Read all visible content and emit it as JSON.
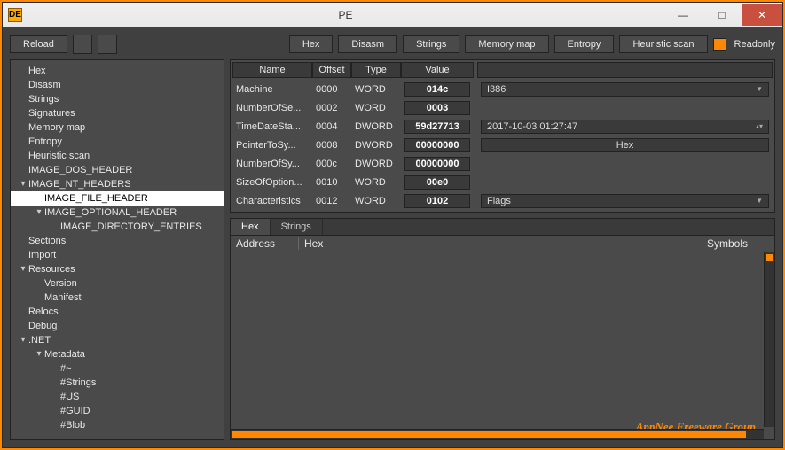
{
  "window": {
    "title": "PE",
    "icon": "DE"
  },
  "toolbar": {
    "reload": "Reload",
    "hex": "Hex",
    "disasm": "Disasm",
    "strings": "Strings",
    "memory_map": "Memory map",
    "entropy": "Entropy",
    "heuristic": "Heuristic scan",
    "readonly": "Readonly"
  },
  "tree": [
    {
      "lvl": 1,
      "tw": "",
      "label": "Hex"
    },
    {
      "lvl": 1,
      "tw": "",
      "label": "Disasm"
    },
    {
      "lvl": 1,
      "tw": "",
      "label": "Strings"
    },
    {
      "lvl": 1,
      "tw": "",
      "label": "Signatures"
    },
    {
      "lvl": 1,
      "tw": "",
      "label": "Memory map"
    },
    {
      "lvl": 1,
      "tw": "",
      "label": "Entropy"
    },
    {
      "lvl": 1,
      "tw": "",
      "label": "Heuristic scan"
    },
    {
      "lvl": 1,
      "tw": "",
      "label": "IMAGE_DOS_HEADER"
    },
    {
      "lvl": 1,
      "tw": "▾",
      "label": "IMAGE_NT_HEADERS"
    },
    {
      "lvl": 2,
      "tw": "",
      "label": "IMAGE_FILE_HEADER",
      "sel": true
    },
    {
      "lvl": 2,
      "tw": "▾",
      "label": "IMAGE_OPTIONAL_HEADER"
    },
    {
      "lvl": 3,
      "tw": "",
      "label": "IMAGE_DIRECTORY_ENTRIES"
    },
    {
      "lvl": 1,
      "tw": "",
      "label": "Sections"
    },
    {
      "lvl": 1,
      "tw": "",
      "label": "Import"
    },
    {
      "lvl": 1,
      "tw": "▾",
      "label": "Resources"
    },
    {
      "lvl": 2,
      "tw": "",
      "label": "Version"
    },
    {
      "lvl": 2,
      "tw": "",
      "label": "Manifest"
    },
    {
      "lvl": 1,
      "tw": "",
      "label": "Relocs"
    },
    {
      "lvl": 1,
      "tw": "",
      "label": "Debug"
    },
    {
      "lvl": 1,
      "tw": "▾",
      "label": ".NET"
    },
    {
      "lvl": 2,
      "tw": "▾",
      "label": "Metadata"
    },
    {
      "lvl": 3,
      "tw": "",
      "label": "#~"
    },
    {
      "lvl": 3,
      "tw": "",
      "label": "#Strings"
    },
    {
      "lvl": 3,
      "tw": "",
      "label": "#US"
    },
    {
      "lvl": 3,
      "tw": "",
      "label": "#GUID"
    },
    {
      "lvl": 3,
      "tw": "",
      "label": "#Blob"
    }
  ],
  "grid": {
    "headers": {
      "name": "Name",
      "offset": "Offset",
      "type": "Type",
      "value": "Value"
    },
    "rows": [
      {
        "name": "Machine",
        "offset": "0000",
        "type": "WORD",
        "value": "014c",
        "extra_kind": "combo",
        "extra": "I386"
      },
      {
        "name": "NumberOfSe...",
        "offset": "0002",
        "type": "WORD",
        "value": "0003"
      },
      {
        "name": "TimeDateSta...",
        "offset": "0004",
        "type": "DWORD",
        "value": "59d27713",
        "extra_kind": "spin",
        "extra": "2017-10-03 01:27:47"
      },
      {
        "name": "PointerToSy...",
        "offset": "0008",
        "type": "DWORD",
        "value": "00000000",
        "extra_kind": "btn",
        "extra": "Hex"
      },
      {
        "name": "NumberOfSy...",
        "offset": "000c",
        "type": "DWORD",
        "value": "00000000"
      },
      {
        "name": "SizeOfOption...",
        "offset": "0010",
        "type": "WORD",
        "value": "00e0"
      },
      {
        "name": "Characteristics",
        "offset": "0012",
        "type": "WORD",
        "value": "0102",
        "extra_kind": "combo",
        "extra": "Flags"
      }
    ]
  },
  "dump": {
    "tabs": [
      "Hex",
      "Strings"
    ],
    "active_tab": 0,
    "cols": {
      "address": "Address",
      "hex": "Hex",
      "symbols": "Symbols"
    }
  },
  "watermark": "AppNee Freeware Group."
}
